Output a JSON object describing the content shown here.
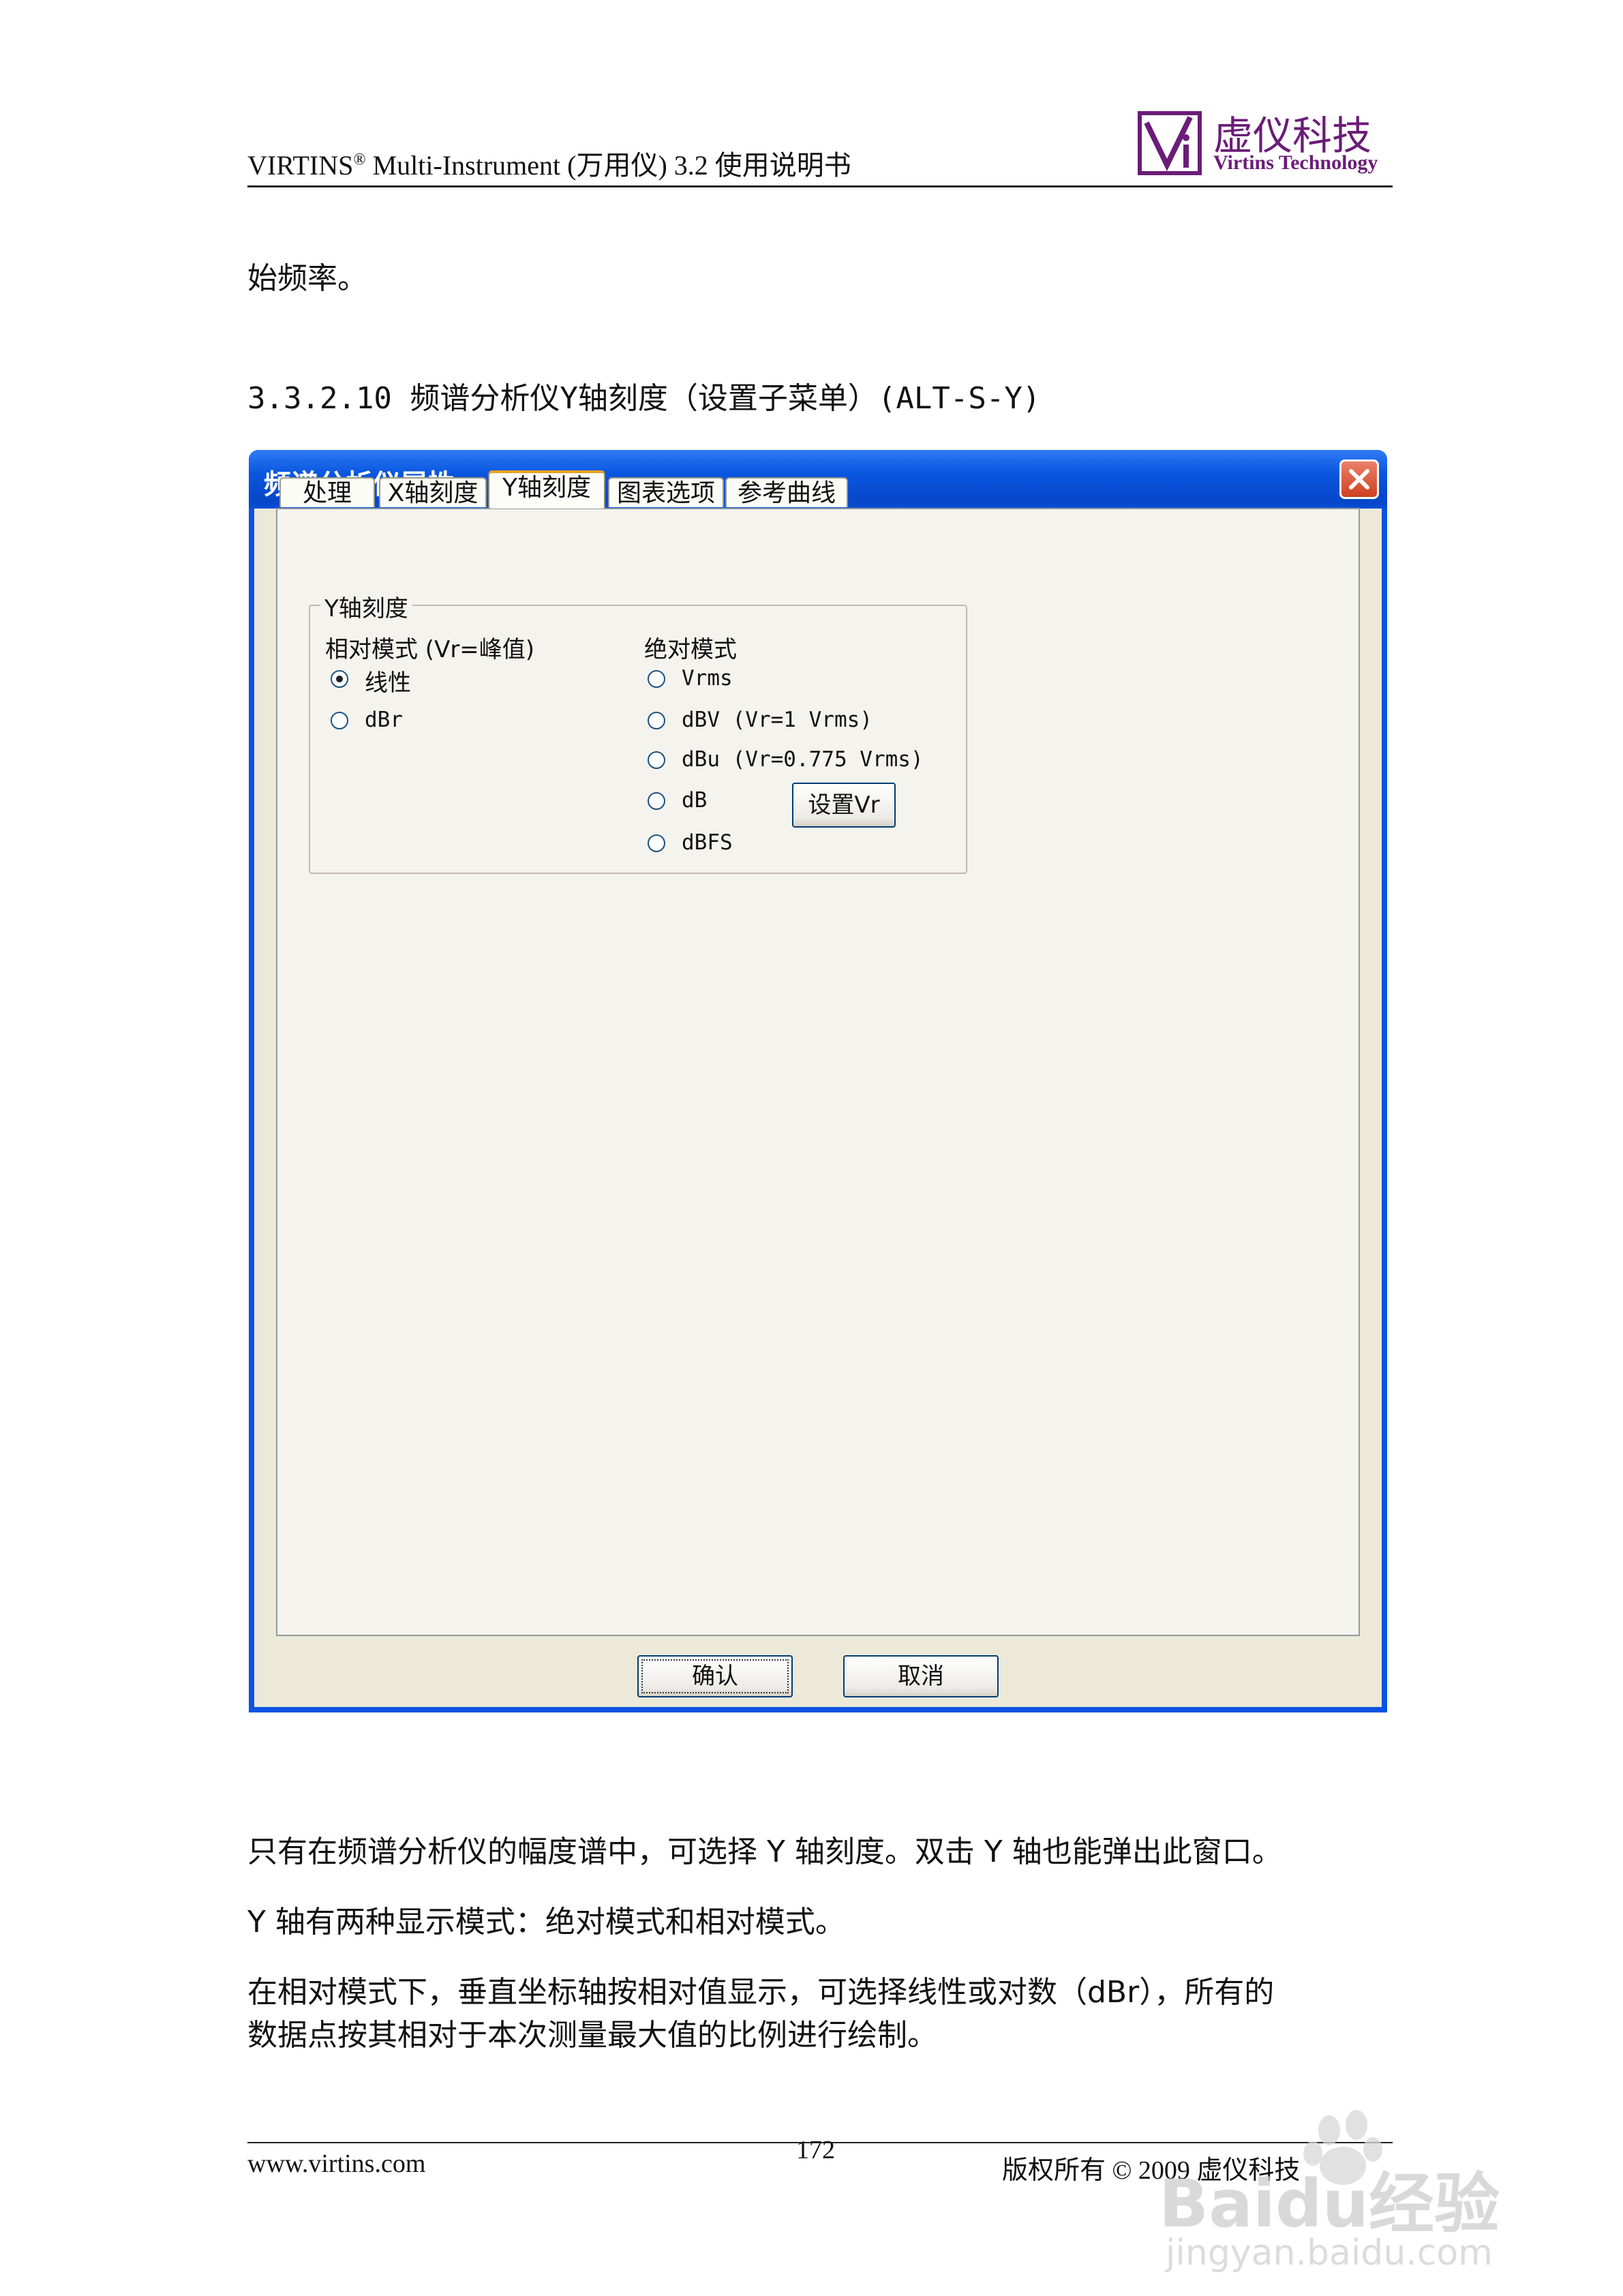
{
  "header": {
    "product": "VIRTINS",
    "registered": "®",
    "title_rest": " Multi-Instrument (万用仪) 3.2 使用说明书",
    "logo_cn": "虚仪科技",
    "logo_en": "Virtins Technology"
  },
  "body": {
    "continuation": "始频率。",
    "section_title": "3.3.2.10 频谱分析仪Y轴刻度（设置子菜单）(ALT-S-Y)",
    "paragraphs": [
      "只有在频谱分析仪的幅度谱中，可选择 Y 轴刻度。双击 Y 轴也能弹出此窗口。",
      "Y 轴有两种显示模式：绝对模式和相对模式。",
      "在相对模式下，垂直坐标轴按相对值显示，可选择线性或对数（dBr），所有的",
      "数据点按其相对于本次测量最大值的比例进行绘制。"
    ]
  },
  "dialog": {
    "title": "频谱分析仪属性",
    "tabs": [
      "处理",
      "X轴刻度",
      "Y轴刻度",
      "图表选项",
      "参考曲线"
    ],
    "active_tab": "Y轴刻度",
    "group_label": "Y轴刻度",
    "relative_label": "相对模式 (Vr=峰值)",
    "absolute_label": "绝对模式",
    "relative_options": [
      "线性",
      "dBr"
    ],
    "absolute_options": [
      "Vrms",
      "dBV (Vr=1 Vrms)",
      "dBu (Vr=0.775 Vrms)",
      "dB",
      "dBFS"
    ],
    "selected_option": "线性",
    "set_vr_button": "设置Vr",
    "ok_button": "确认",
    "cancel_button": "取消"
  },
  "footer": {
    "website": "www.virtins.com",
    "page_number": "172",
    "copyright": "版权所有 © 2009 虚仪科技"
  },
  "watermark": {
    "text_main": "Baidu经验",
    "text_sub": "jingyan.baidu.com"
  },
  "colors": {
    "titlebar": "#0a54e3",
    "dialog_face": "#ece9d8",
    "logo": "#6b1c78"
  }
}
